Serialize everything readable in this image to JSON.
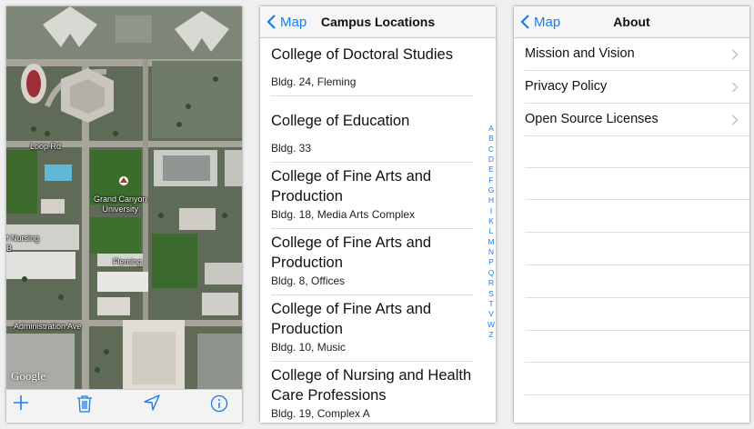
{
  "map": {
    "labels": {
      "loop_rd": "Loop Rd",
      "university": "Grand Canyon\nUniversity",
      "nursing": "College of Nursing\nComplex B",
      "fleming": "Fleming",
      "admin_ave": "Administration Ave",
      "google": "Google"
    },
    "toolbar_icons": [
      "plus-icon",
      "trash-icon",
      "location-arrow-icon",
      "info-icon"
    ],
    "accent": "#1a7cf0"
  },
  "locations": {
    "back_label": "Map",
    "title": "Campus Locations",
    "items": [
      {
        "name": "College of Doctoral Studies",
        "building": "Bldg. 24, Fleming"
      },
      {
        "name": "College of Education",
        "building": "Bldg. 33"
      },
      {
        "name": "College of Fine Arts and Production",
        "building": "Bldg. 18, Media Arts Complex"
      },
      {
        "name": "College of Fine Arts and Production",
        "building": "Bldg. 8, Offices"
      },
      {
        "name": "College of Fine Arts and Production",
        "building": "Bldg. 10, Music"
      },
      {
        "name": "College of Nursing and Health Care Professions",
        "building": "Bldg. 19, Complex A"
      }
    ],
    "index": [
      "A",
      "B",
      "C",
      "D",
      "E",
      "F",
      "G",
      "H",
      "I",
      "K",
      "L",
      "M",
      "N",
      "P",
      "Q",
      "R",
      "S",
      "T",
      "V",
      "W",
      "Z"
    ]
  },
  "about": {
    "back_label": "Map",
    "title": "About",
    "items": [
      {
        "label": "Mission and Vision"
      },
      {
        "label": "Privacy Policy"
      },
      {
        "label": "Open Source Licenses"
      }
    ]
  }
}
